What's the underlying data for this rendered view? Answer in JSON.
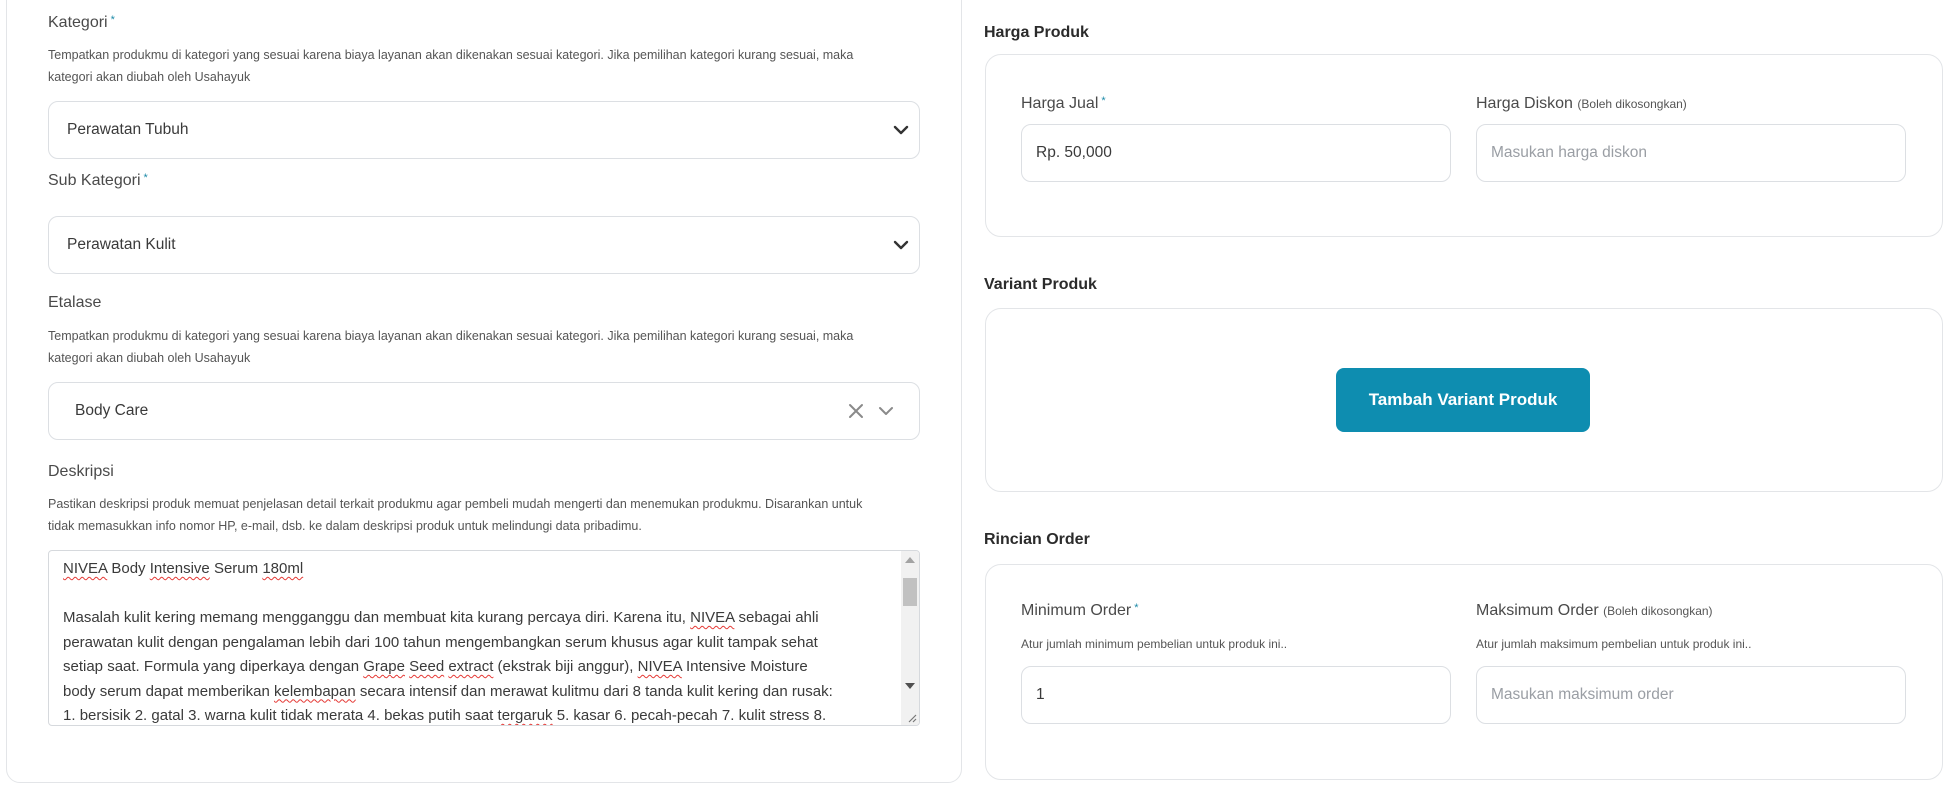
{
  "left": {
    "kategori": {
      "label": "Kategori",
      "required_mark": "*",
      "help_line1": "Tempatkan produkmu di kategori yang sesuai karena biaya layanan akan dikenakan sesuai kategori. Jika pemilihan kategori kurang sesuai, maka",
      "help_line2": "kategori akan diubah oleh Usahayuk",
      "value": "Perawatan Tubuh"
    },
    "sub_kategori": {
      "label": "Sub Kategori",
      "required_mark": "*",
      "value": "Perawatan Kulit"
    },
    "etalase": {
      "label": "Etalase",
      "help_line1": "Tempatkan produkmu di kategori yang sesuai karena biaya layanan akan dikenakan sesuai kategori. Jika pemilihan kategori kurang sesuai, maka",
      "help_line2": "kategori akan diubah oleh Usahayuk",
      "value": "Body Care"
    },
    "deskripsi": {
      "label": "Deskripsi",
      "help_line1": "Pastikan deskripsi produk memuat penjelasan detail terkait produkmu agar pembeli mudah mengerti dan menemukan produkmu. Disarankan untuk",
      "help_line2": "tidak memasukkan info nomor HP, e-mail, dsb. ke dalam deskripsi produk untuk melindungi data pribadimu.",
      "lines": [
        "NIVEA Body Intensive Serum 180ml",
        "",
        "Masalah kulit kering memang mengganggu dan membuat kita kurang percaya diri. Karena itu, NIVEA sebagai ahli",
        "perawatan kulit dengan pengalaman lebih dari 100 tahun mengembangkan serum khusus agar kulit tampak sehat",
        "setiap saat. Formula yang diperkaya dengan Grape Seed extract (ekstrak biji anggur), NIVEA Intensive Moisture",
        "body serum dapat memberikan kelembapan secara intensif dan merawat kulitmu dari 8 tanda kulit kering dan rusak:",
        "1. bersisik 2. gatal 3. warna kulit tidak merata 4. bekas putih saat tergaruk 5. kasar 6. pecah-pecah 7. kulit stress 8."
      ]
    }
  },
  "harga": {
    "title": "Harga Produk",
    "jual_label": "Harga Jual",
    "required_mark": "*",
    "jual_value": "Rp. 50,000",
    "diskon_label": "Harga Diskon",
    "diskon_note": "(Boleh dikosongkan)",
    "diskon_placeholder": "Masukan harga diskon"
  },
  "variant": {
    "title": "Variant Produk",
    "button_label": "Tambah Variant Produk"
  },
  "order": {
    "title": "Rincian Order",
    "min_label": "Minimum Order",
    "required_mark": "*",
    "min_hint": "Atur jumlah minimum pembelian untuk produk ini..",
    "min_value": "1",
    "max_label": "Maksimum Order",
    "max_note": "(Boleh dikosongkan)",
    "max_hint": "Atur jumlah maksimum pembelian untuk produk ini..",
    "max_placeholder": "Masukan maksimum order"
  },
  "colors": {
    "accent": "#0e8db0",
    "border": "#dcdfe3",
    "spellcheck": "#e53935"
  },
  "icons": {
    "dropdown": "chevron-down-icon",
    "clear": "close-icon",
    "resize": "resize-grip-icon"
  }
}
